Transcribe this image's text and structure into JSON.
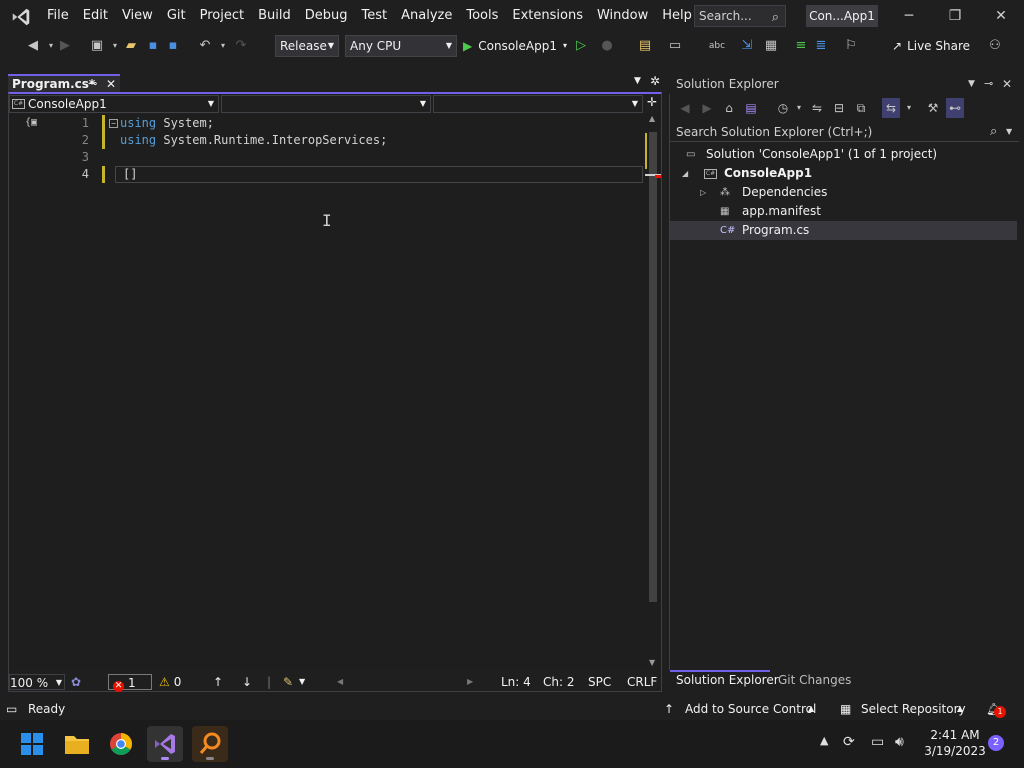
{
  "menu": {
    "items": [
      "File",
      "Edit",
      "View",
      "Git",
      "Project",
      "Build",
      "Debug",
      "Test",
      "Analyze",
      "Tools",
      "Extensions",
      "Window",
      "Help"
    ],
    "search_placeholder": "Search...",
    "project_title": "Con...App1"
  },
  "toolbar": {
    "configuration": "Release",
    "platform": "Any CPU",
    "start_target": "ConsoleApp1",
    "live_share": "Live Share"
  },
  "editor": {
    "tab_label": "Program.cs*",
    "nav_project": "ConsoleApp1",
    "lines": [
      {
        "number": "1",
        "keyword": "using",
        "rest": " System;"
      },
      {
        "number": "2",
        "keyword": "using",
        "rest": " System.Runtime.InteropServices;"
      },
      {
        "number": "3",
        "keyword": "",
        "rest": ""
      },
      {
        "number": "4",
        "keyword": "",
        "rest": "[]"
      }
    ]
  },
  "editor_status": {
    "zoom": "100 %",
    "errors": "1",
    "warnings": "0",
    "line": "Ln: 4",
    "char": "Ch: 2",
    "spacing": "SPC",
    "line_ending": "CRLF"
  },
  "solution_explorer": {
    "title": "Solution Explorer",
    "search_placeholder": "Search Solution Explorer (Ctrl+;)",
    "tree": {
      "solution": "Solution 'ConsoleApp1' (1 of 1 project)",
      "project": "ConsoleApp1",
      "dependencies": "Dependencies",
      "manifest": "app.manifest",
      "program": "Program.cs"
    },
    "tabs": [
      "Solution Explorer",
      "Git Changes"
    ]
  },
  "statusbar": {
    "ready": "Ready",
    "source_control": "Add to Source Control",
    "repository": "Select Repository",
    "notifications": "1"
  },
  "taskbar": {
    "time": "2:41 AM",
    "date": "3/19/2023",
    "notification_count": "2"
  },
  "colors": {
    "accent": "#7160e8",
    "keyword": "#569cd6",
    "error": "#e51400",
    "modified_marker": "#c5b52d"
  }
}
